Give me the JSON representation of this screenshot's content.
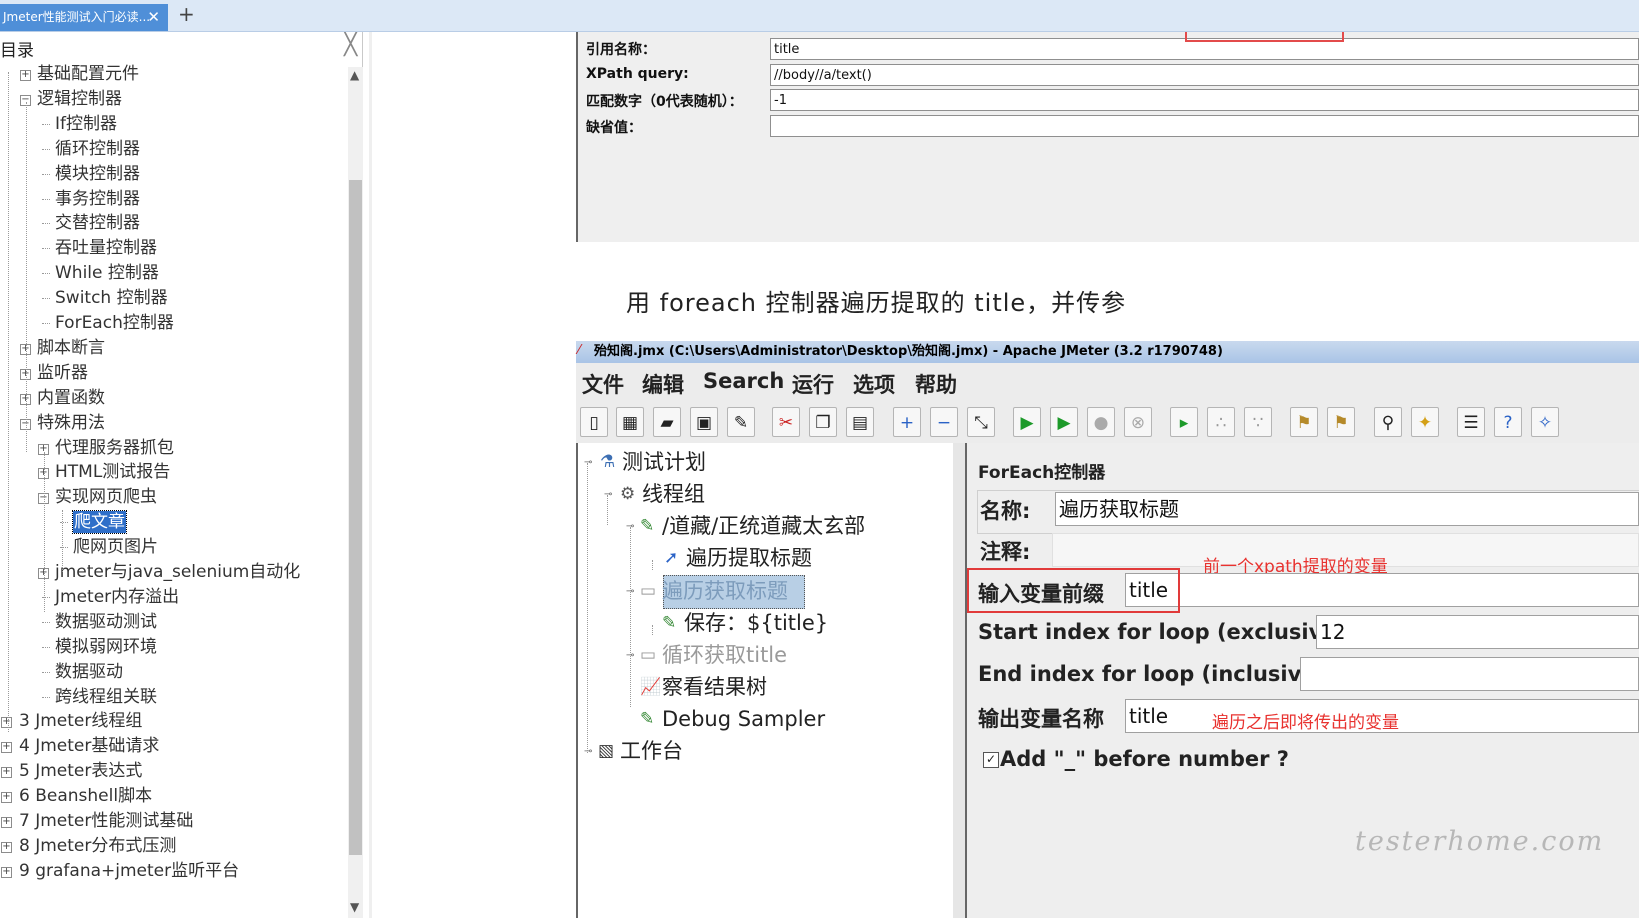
{
  "tab": {
    "title": "Jmeter性能测试入门必读...",
    "close": "✕",
    "add": "+"
  },
  "toc": {
    "title": "目录",
    "close": "╳",
    "scroll_up": "▲",
    "scroll_down": "▼",
    "items": [
      {
        "label": "基础配置元件",
        "pm": "+"
      },
      {
        "label": "逻辑控制器",
        "pm": "−"
      },
      {
        "label": "If控制器"
      },
      {
        "label": "循环控制器"
      },
      {
        "label": "模块控制器"
      },
      {
        "label": "事务控制器"
      },
      {
        "label": "交替控制器"
      },
      {
        "label": "吞吐量控制器"
      },
      {
        "label": "While 控制器"
      },
      {
        "label": "Switch 控制器"
      },
      {
        "label": "ForEach控制器"
      },
      {
        "label": "脚本断言",
        "pm": "+"
      },
      {
        "label": "监听器",
        "pm": "+"
      },
      {
        "label": "内置函数",
        "pm": "+"
      },
      {
        "label": "特殊用法",
        "pm": "−"
      },
      {
        "label": "代理服务器抓包",
        "pm": "+"
      },
      {
        "label": "HTML测试报告",
        "pm": "+"
      },
      {
        "label": "实现网页爬虫",
        "pm": "−"
      },
      {
        "label": "爬文章",
        "selected": true
      },
      {
        "label": "爬网页图片"
      },
      {
        "label": "jmeter与java_selenium自动化",
        "pm": "+"
      },
      {
        "label": "Jmeter内存溢出"
      },
      {
        "label": "数据驱动测试"
      },
      {
        "label": "模拟弱网环境"
      },
      {
        "label": "数据驱动"
      },
      {
        "label": "跨线程组关联"
      },
      {
        "label": "3 Jmeter线程组",
        "pm": "+"
      },
      {
        "label": "4 Jmeter基础请求",
        "pm": "+"
      },
      {
        "label": "5 Jmeter表达式",
        "pm": "+"
      },
      {
        "label": "6 Beanshell脚本",
        "pm": "+"
      },
      {
        "label": "7 Jmeter性能测试基础",
        "pm": "+"
      },
      {
        "label": "8 Jmeter分布式压测",
        "pm": "+"
      },
      {
        "label": "9 grafana+jmeter监听平台",
        "pm": "+"
      }
    ]
  },
  "xpath_panel": {
    "ref_name_label": "引用名称：",
    "ref_name_value": "title",
    "query_label": "XPath query:",
    "query_value": "//body//a/text()",
    "match_no_label": "匹配数字（0代表随机）：",
    "match_no_value": "-1",
    "default_label": "缺省值：",
    "default_value": ""
  },
  "caption": "用 foreach 控制器遍历提取的 title，并传参",
  "jmeter": {
    "window_title": "殆知阁.jmx (C:\\Users\\Administrator\\Desktop\\殆知阁.jmx) - Apache JMeter (3.2 r1790748)",
    "menu": [
      "文件",
      "编辑",
      "Search",
      "运行",
      "选项",
      "帮助"
    ],
    "tree": [
      {
        "label": "测试计划",
        "icon": "⚗"
      },
      {
        "label": "线程组",
        "icon": "⚙"
      },
      {
        "label": "/道藏/正统道藏太玄部",
        "icon": "✎"
      },
      {
        "label": "遍历提取标题",
        "icon": "➚"
      },
      {
        "label": "遍历获取标题",
        "icon": "▭"
      },
      {
        "label": "保存：${title}",
        "icon": "✎"
      },
      {
        "label": "循环获取title",
        "icon": "▭"
      },
      {
        "label": "察看结果树",
        "icon": "📈"
      },
      {
        "label": "Debug Sampler",
        "icon": "✎"
      },
      {
        "label": "工作台",
        "icon": "▧"
      }
    ],
    "form": {
      "title": "ForEach控制器",
      "name_label": "名称:",
      "name_value": "遍历获取标题",
      "comment_label": "注释:",
      "input_prefix_label": "输入变量前缀",
      "input_prefix_value": "title",
      "start_label": "Start index for loop (exclusive)",
      "start_value": "12",
      "end_label": "End index for loop (inclusive)",
      "end_value": "",
      "output_label": "输出变量名称",
      "output_value": "title",
      "add_underscore_label": "Add \"_\" before number ?",
      "add_underscore_checked": "✓"
    },
    "annotations": {
      "prefix_note": "前一个xpath提取的变量",
      "output_note": "遍历之后即将传出的变量"
    }
  },
  "watermark": "testerhome.com",
  "colors": {
    "tab_active": "#4f8fd8",
    "annotation_red": "#e8322f",
    "selection": "#b8cfe5"
  }
}
